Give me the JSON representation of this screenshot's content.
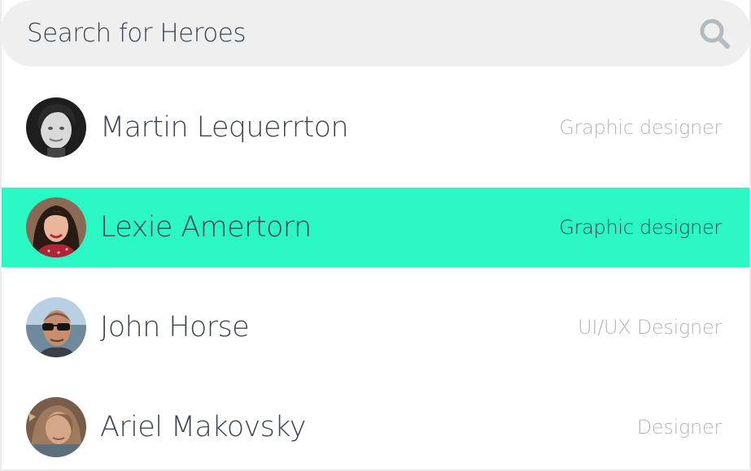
{
  "search": {
    "placeholder": "Search for Heroes",
    "value": "",
    "icon": "search-icon"
  },
  "colors": {
    "selected_row": "#2af7c3",
    "search_bg": "#efefef",
    "name_text": "#3b4650",
    "role_text": "#b1b6ba"
  },
  "people": [
    {
      "name": "Martin Lequerrton",
      "role": "Graphic designer",
      "selected": false,
      "avatar": "avatar-martin"
    },
    {
      "name": "Lexie Amertorn",
      "role": "Graphic designer",
      "selected": true,
      "avatar": "avatar-lexie"
    },
    {
      "name": "John Horse",
      "role": "UI/UX Designer",
      "selected": false,
      "avatar": "avatar-john"
    },
    {
      "name": "Ariel Makovsky",
      "role": "Designer",
      "selected": false,
      "avatar": "avatar-ariel"
    }
  ]
}
